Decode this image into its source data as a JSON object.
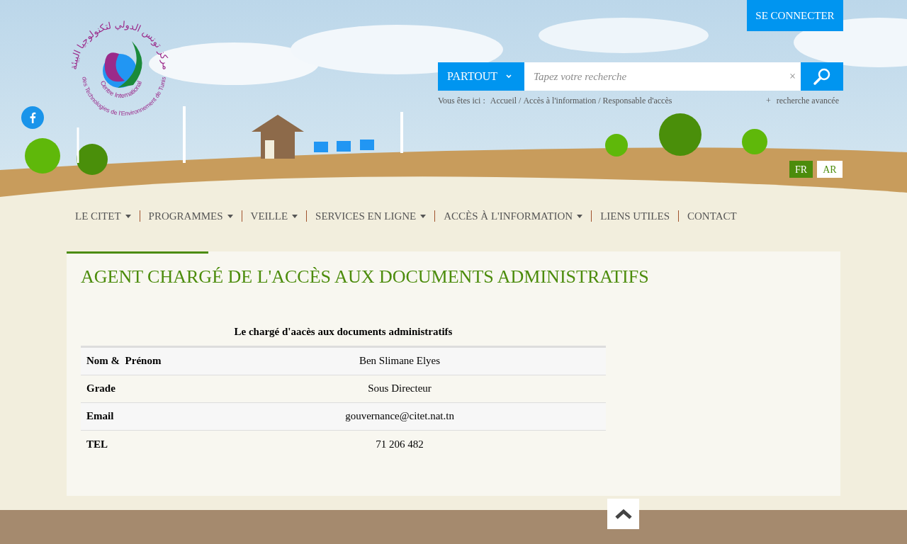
{
  "header": {
    "login_button": "SE CONNECTER",
    "logo": {
      "arabic": "مركز تونس الدولي لتكنولوجيا البيئة",
      "latin_top": "Centre International",
      "latin_bottom": "des Technologies de l'Environnement de Tunis"
    },
    "search": {
      "scope": "PARTOUT",
      "placeholder": "Tapez votre recherche",
      "clear": "×",
      "advanced_mark": "+",
      "advanced": "recherche avancée"
    },
    "breadcrumb": {
      "label": "Vous êtes ici :",
      "separator": "/",
      "items": [
        {
          "label": "Accueil"
        },
        {
          "label": "Accès à l'information"
        },
        {
          "label": "Responsable d'accès"
        }
      ]
    },
    "languages": [
      {
        "label": "FR",
        "selected": true
      },
      {
        "label": "AR",
        "selected": false
      }
    ]
  },
  "nav": [
    {
      "label": "LE CITET",
      "dropdown": true
    },
    {
      "label": "PROGRAMMES",
      "dropdown": true
    },
    {
      "label": "VEILLE",
      "dropdown": true
    },
    {
      "label": "SERVICES EN LIGNE",
      "dropdown": true
    },
    {
      "label": "ACCÈS À L'INFORMATION",
      "dropdown": true
    },
    {
      "label": "LIENS UTILES",
      "dropdown": false
    },
    {
      "label": "CONTACT",
      "dropdown": false
    }
  ],
  "page": {
    "title": "AGENT CHARGÉ DE L'ACCÈS AUX DOCUMENTS ADMINISTRATIFS",
    "table": {
      "caption": "Le chargé d'aacès aux documents administratifs",
      "rows": [
        {
          "label": "Nom &  Prénom",
          "value": "Ben Slimane Elyes"
        },
        {
          "label": "Grade",
          "value": "Sous Directeur"
        },
        {
          "label": "Email",
          "value": "gouvernance@citet.nat.tn"
        },
        {
          "label": "TEL",
          "value": "71 206 482"
        }
      ]
    }
  }
}
